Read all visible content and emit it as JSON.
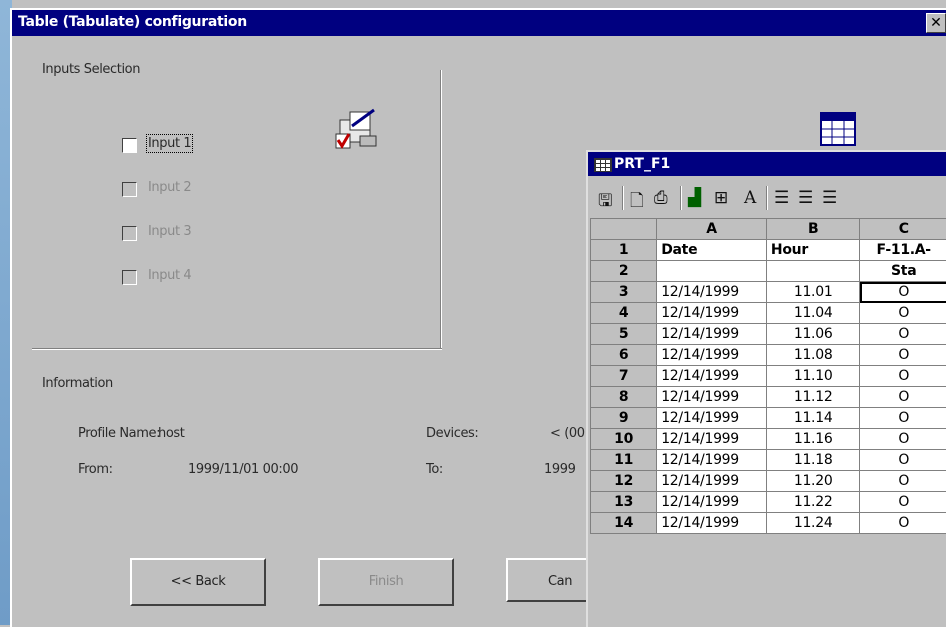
{
  "dialog": {
    "title": "Table (Tabulate) configuration",
    "close_label": "✕"
  },
  "inputs_section": {
    "title": "Inputs Selection",
    "items": [
      {
        "label": "Input 1",
        "checked": false,
        "enabled": true
      },
      {
        "label": "Input 2",
        "checked": false,
        "enabled": false
      },
      {
        "label": "Input 3",
        "checked": false,
        "enabled": false
      },
      {
        "label": "Input 4",
        "checked": false,
        "enabled": false
      }
    ]
  },
  "info_section": {
    "title": "Information",
    "profile_label": "Profile Name:",
    "profile_value": "host",
    "devices_label": "Devices:",
    "devices_value": "< (00",
    "from_label": "From:",
    "from_value": "1999/11/01  00:00",
    "to_label": "To:",
    "to_value": "1999"
  },
  "buttons": {
    "back": "<< Back",
    "finish": "Finish",
    "cancel": "Can"
  },
  "spreadsheet": {
    "title": "PRT_F1",
    "toolbar_icons": [
      "save-icon",
      "print-preview-icon",
      "print-icon",
      "chart-icon",
      "table-icon",
      "font-icon",
      "align-left-icon",
      "align-center-icon",
      "align-right-icon"
    ],
    "columns": [
      "A",
      "B",
      "C"
    ],
    "rows": [
      {
        "n": "1",
        "a": "Date",
        "b": "Hour",
        "c": "F-11.A-"
      },
      {
        "n": "2",
        "a": "",
        "b": "",
        "c": "Sta"
      },
      {
        "n": "3",
        "a": "12/14/1999",
        "b": "11.01",
        "c": "O"
      },
      {
        "n": "4",
        "a": "12/14/1999",
        "b": "11.04",
        "c": "O"
      },
      {
        "n": "5",
        "a": "12/14/1999",
        "b": "11.06",
        "c": "O"
      },
      {
        "n": "6",
        "a": "12/14/1999",
        "b": "11.08",
        "c": "O"
      },
      {
        "n": "7",
        "a": "12/14/1999",
        "b": "11.10",
        "c": "O"
      },
      {
        "n": "8",
        "a": "12/14/1999",
        "b": "11.12",
        "c": "O"
      },
      {
        "n": "9",
        "a": "12/14/1999",
        "b": "11.14",
        "c": "O"
      },
      {
        "n": "10",
        "a": "12/14/1999",
        "b": "11.16",
        "c": "O"
      },
      {
        "n": "11",
        "a": "12/14/1999",
        "b": "11.18",
        "c": "O"
      },
      {
        "n": "12",
        "a": "12/14/1999",
        "b": "11.20",
        "c": "O"
      },
      {
        "n": "13",
        "a": "12/14/1999",
        "b": "11.22",
        "c": "O"
      },
      {
        "n": "14",
        "a": "12/14/1999",
        "b": "11.24",
        "c": "O"
      }
    ]
  },
  "colors": {
    "title_bar": "#000080",
    "face": "#c0c0c0",
    "desktop": "#6f9cc7"
  }
}
